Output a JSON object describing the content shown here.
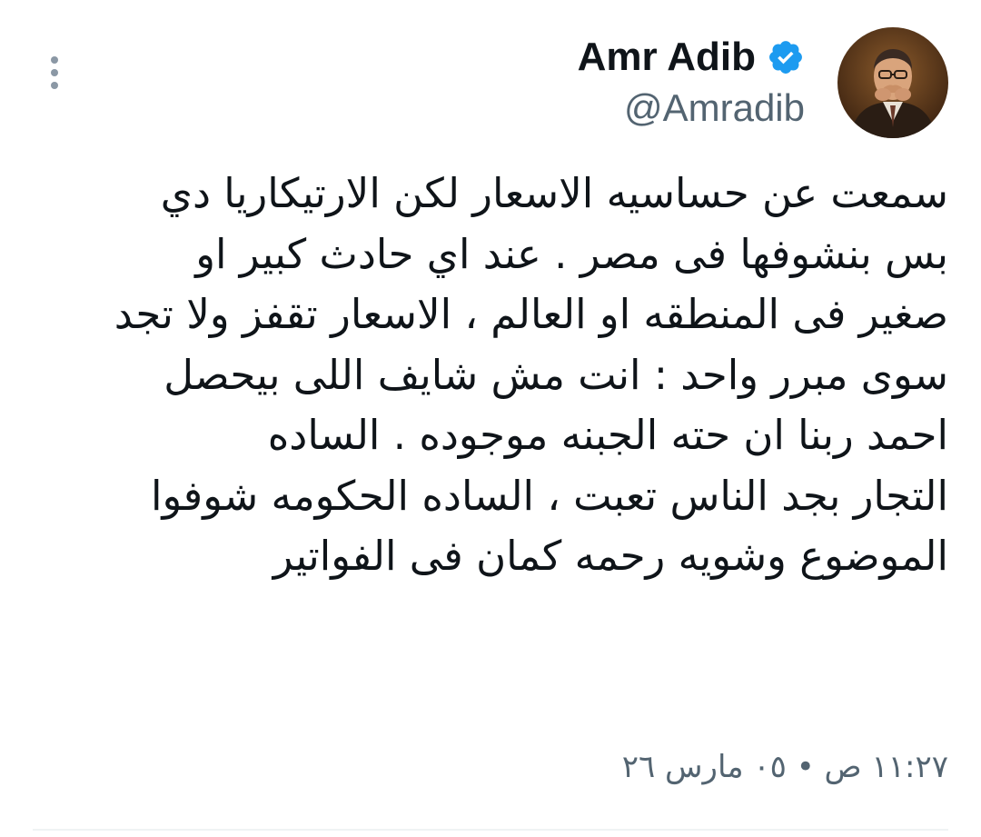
{
  "author": {
    "display_name": "Amr Adib",
    "handle": "@Amradib",
    "verified": true,
    "avatar_icon": "profile-photo"
  },
  "tweet": {
    "lines": [
      "سمعت عن حساسيه الاسعار لكن الارتيكاريا دي",
      "بس بنشوفها فى مصر . عند اي حادث كبير او",
      "صغير فى المنطقه او العالم ، الاسعار تقفز ولا تجد",
      "سوى مبرر واحد : انت مش شايف اللى بيحصل",
      "احمد ربنا ان حته الجبنه موجوده . الساده",
      "التجار بجد الناس تعبت ، الساده الحكومه شوفوا",
      "الموضوع وشويه رحمه كمان فى الفواتير"
    ],
    "timestamp": "١١:٢٧ ص • ٠٥ مارس ٢٦"
  },
  "colors": {
    "verified_badge": "#1d9bf0",
    "secondary_text": "#536471",
    "primary_text": "#0f1419",
    "more_icon": "#8b98a5"
  },
  "icons": {
    "more": "more-vertical-icon",
    "verified": "verified-badge-icon"
  }
}
